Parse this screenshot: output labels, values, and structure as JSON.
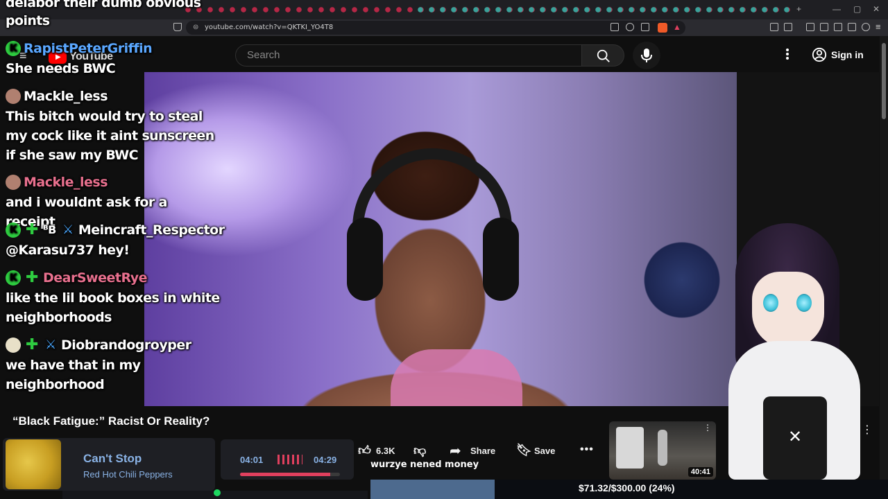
{
  "browser": {
    "url": "youtube.com/watch?v=QKTKI_YO4T8"
  },
  "youtube": {
    "logo": "YouTube",
    "search_placeholder": "Search",
    "signin_label": "Sign in"
  },
  "overlay_caption": {
    "line1": "delabor their dumb obvious",
    "line2": "points"
  },
  "chat": [
    {
      "user": "RapistPeterGriffin",
      "user_color": "#5aa7ff",
      "badges": [
        "K"
      ],
      "message": "She needs BWC"
    },
    {
      "user": "Mackle_less",
      "user_color": "#ffffff",
      "badges": [
        "avatar"
      ],
      "message": "This bitch would try to steal my cock like it aint sunscreen if she saw my BWC"
    },
    {
      "user": "Mackle_less",
      "user_color": "#e8708e",
      "badges": [
        "avatar"
      ],
      "message": "and i wouldnt ask for a receipt"
    },
    {
      "user": "Meincraft_Respector",
      "user_color": "#ffffff",
      "badges": [
        "K",
        "plus",
        "B",
        "sword"
      ],
      "message": "@Karasu737 hey!"
    },
    {
      "user": "DearSweetRye",
      "user_color": "#e8708e",
      "badges": [
        "K",
        "plus"
      ],
      "message": "like the lil book boxes in white neighborhoods"
    },
    {
      "user": "Diobrandogroyper",
      "user_color": "#ffffff",
      "badges": [
        "egg",
        "plus",
        "sword"
      ],
      "message": "we have that in my neighborhood"
    }
  ],
  "video": {
    "title": "“Black Fatigue:” Racist Or Reality?",
    "likes": "6.3K",
    "share_label": "Share",
    "save_label": "Save",
    "overlay_text": "wurzye nened money"
  },
  "music": {
    "song": "Can't Stop",
    "artist": "Red Hot Chili Peppers",
    "current_time": "04:01",
    "total_time": "04:29",
    "progress": 0.9
  },
  "recommended": {
    "duration": "40:41"
  },
  "donation": {
    "text": "$71.32/$300.00 (24%)",
    "progress": 0.24
  },
  "colors": {
    "accent_red": "#e0405e",
    "music_text": "#8ab3e6",
    "k_badge": "#2ecc40"
  }
}
